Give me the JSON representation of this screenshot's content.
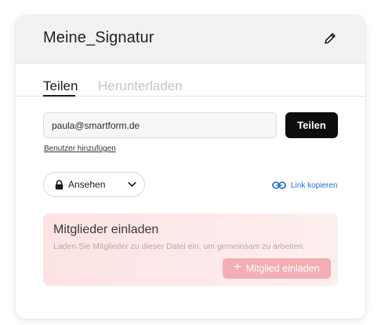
{
  "dialog": {
    "title": "Meine_Signatur"
  },
  "tabs": {
    "share": "Teilen",
    "download": "Herunterladen"
  },
  "share": {
    "email_value": "paula@smartform.de",
    "email_placeholder": "",
    "share_button": "Teilen",
    "add_user_link": "Benutzer hinzufügen"
  },
  "permission": {
    "selected": "Ansehen",
    "icon": "lock-icon"
  },
  "copy_link": {
    "label": "Link kopieren",
    "icon": "link-icon"
  },
  "invite": {
    "title": "Mitglieder einladen",
    "description": "Laden Sie Mitglieder zu dieser Datei ein, um gemeinsam zu arbeiten.",
    "button": "Mitglied einladen",
    "button_icon": "plus-icon"
  },
  "colors": {
    "accent_link": "#1f6fd1",
    "primary_button": "#0d0d0d",
    "invite_button": "#f3aeb3",
    "invite_background": "#fde3e4"
  }
}
